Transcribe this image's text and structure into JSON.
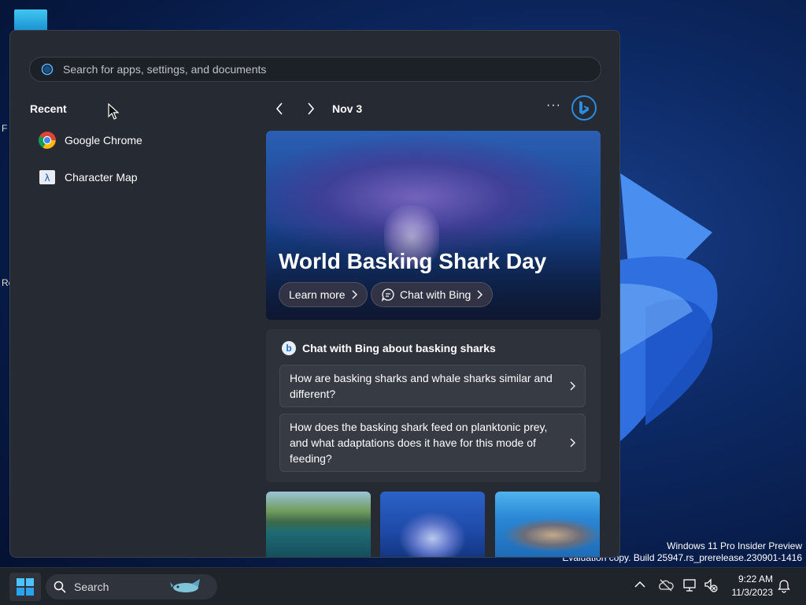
{
  "search": {
    "placeholder": "Search for apps, settings, and documents"
  },
  "recent": {
    "title": "Recent",
    "items": [
      {
        "label": "Google Chrome",
        "icon": "chrome-icon"
      },
      {
        "label": "Character Map",
        "icon": "character-map-icon"
      }
    ]
  },
  "spotlight": {
    "date": "Nov 3",
    "more_label": "···",
    "hero_title": "World Basking Shark Day",
    "learn_more": "Learn more",
    "chat_with_bing": "Chat with Bing"
  },
  "chat": {
    "heading": "Chat with Bing about basking sharks",
    "questions": [
      "How are basking sharks and whale sharks similar and different?",
      "How does the basking shark feed on planktonic prey, and what adaptations does it have for this mode of feeding?"
    ]
  },
  "watermark": {
    "line1": "Windows 11 Pro Insider Preview",
    "line2": "Evaluation copy. Build 25947.rs_prerelease.230901-1416"
  },
  "taskbar": {
    "search_label": "Search",
    "time": "9:22 AM",
    "date": "11/3/2023"
  },
  "desktop": {
    "frag1": "F",
    "frag2": "Re"
  },
  "colors": {
    "accent": "#2a8de0",
    "panel": "#252a33",
    "taskbar": "#1f232a"
  }
}
